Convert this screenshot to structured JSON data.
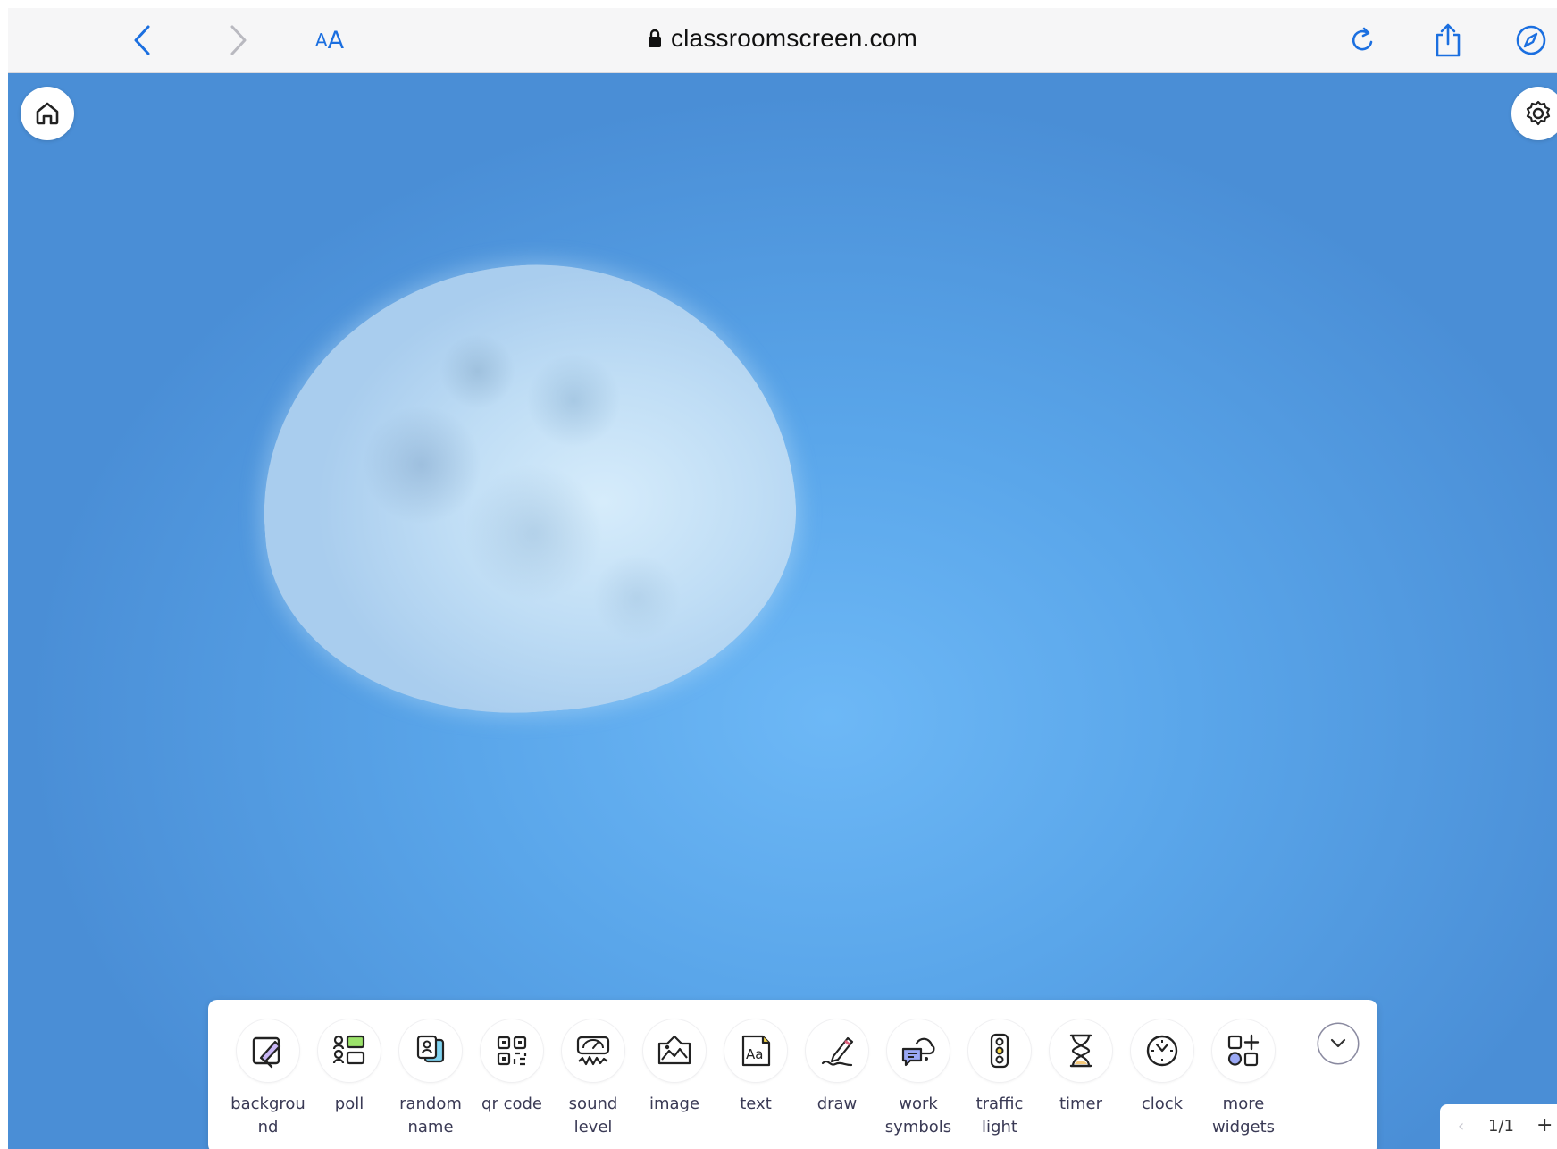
{
  "browser": {
    "url": "classroomscreen.com",
    "text_size_label_small": "A",
    "text_size_label_big": "A",
    "accent_color": "#1b6fe0"
  },
  "canvas": {
    "background": "moon photo on blue sky",
    "sky_color": "#5aa6ea"
  },
  "toolbar": {
    "tools": [
      {
        "label": "backgrou\nnd",
        "icon": "background-icon"
      },
      {
        "label": "poll",
        "icon": "poll-icon"
      },
      {
        "label": "random\nname",
        "icon": "random-name-icon"
      },
      {
        "label": "qr code",
        "icon": "qr-code-icon"
      },
      {
        "label": "sound\nlevel",
        "icon": "sound-level-icon"
      },
      {
        "label": "image",
        "icon": "image-icon"
      },
      {
        "label": "text",
        "icon": "text-icon"
      },
      {
        "label": "draw",
        "icon": "draw-icon"
      },
      {
        "label": "work\nsymbols",
        "icon": "work-symbols-icon"
      },
      {
        "label": "traffic\nlight",
        "icon": "traffic-light-icon"
      },
      {
        "label": "timer",
        "icon": "timer-icon"
      },
      {
        "label": "clock",
        "icon": "clock-icon"
      },
      {
        "label": "more\nwidgets",
        "icon": "more-widgets-icon"
      }
    ]
  },
  "pager": {
    "prev": "‹",
    "count": "1/1",
    "add": "+"
  }
}
